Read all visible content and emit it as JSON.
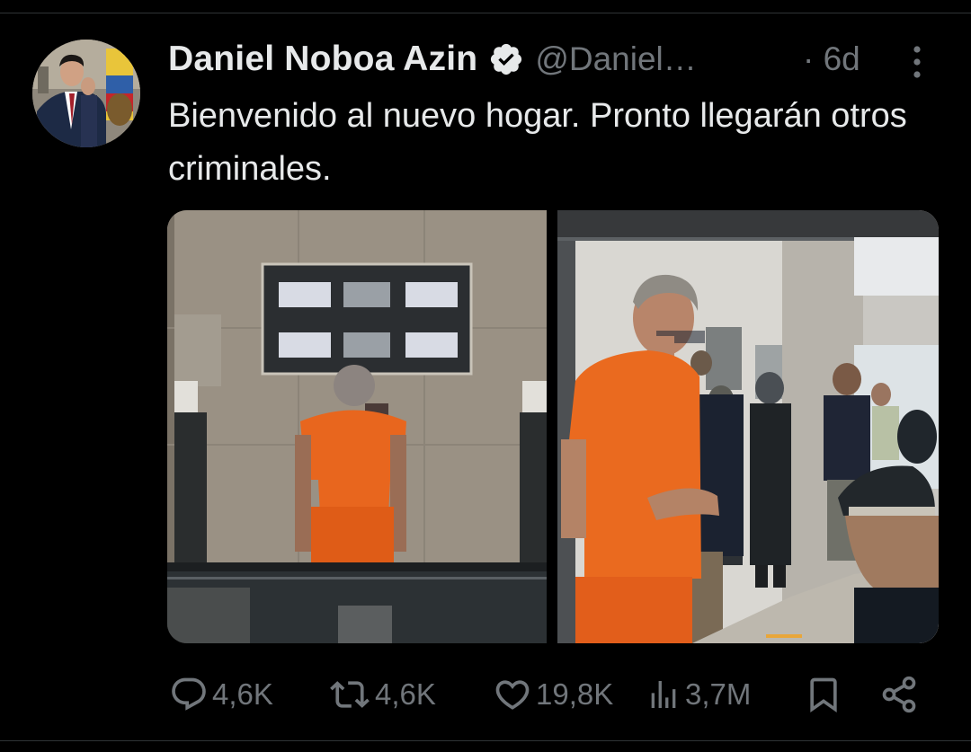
{
  "tweet": {
    "display_name": "Daniel Noboa Azin",
    "handle": "@Daniel…",
    "time": "· 6d",
    "text": "Bienvenido al nuevo hogar. Pronto llegarán otros criminales."
  },
  "icons": {
    "verified": "verified-badge-icon",
    "more": "more-vertical-icon",
    "reply": "reply-icon",
    "retweet": "retweet-icon",
    "like": "heart-icon",
    "views": "views-chart-icon",
    "bookmark": "bookmark-icon",
    "share": "share-icon"
  },
  "actions": {
    "replies": "4,6K",
    "retweets": "4,6K",
    "likes": "19,8K",
    "views": "3,7M"
  },
  "colors": {
    "background": "#000000",
    "text": "#e7e9ea",
    "secondary": "#71767b",
    "prison_orange": "#e8661e"
  }
}
